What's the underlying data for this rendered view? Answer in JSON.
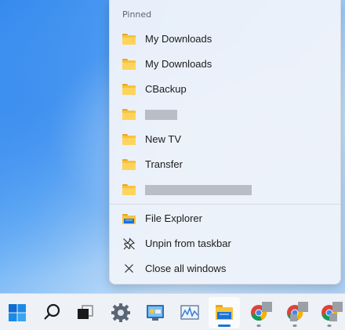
{
  "jumplist": {
    "section_title": "Pinned",
    "pinned": [
      {
        "label": "My Downloads",
        "icon": "folder-icon"
      },
      {
        "label": "My Downloads",
        "icon": "folder-icon"
      },
      {
        "label": "CBackup",
        "icon": "folder-icon"
      },
      {
        "label": "",
        "icon": "folder-icon",
        "redacted": true
      },
      {
        "label": "New TV",
        "icon": "folder-icon"
      },
      {
        "label": "Transfer",
        "icon": "folder-icon"
      },
      {
        "label": "",
        "icon": "folder-icon",
        "redacted": true
      }
    ],
    "actions": [
      {
        "label": "File Explorer",
        "icon": "file-explorer-icon"
      },
      {
        "label": "Unpin from taskbar",
        "icon": "unpin-icon"
      },
      {
        "label": "Close all windows",
        "icon": "close-icon"
      }
    ]
  },
  "taskbar": {
    "accent_color": "#1976d2",
    "icons": [
      "windows-start-icon",
      "search-icon",
      "task-view-icon",
      "settings-icon",
      "control-panel-icon",
      "performance-monitor-icon",
      "file-explorer-icon",
      "chrome-icon",
      "chrome-icon",
      "chrome-icon"
    ]
  }
}
